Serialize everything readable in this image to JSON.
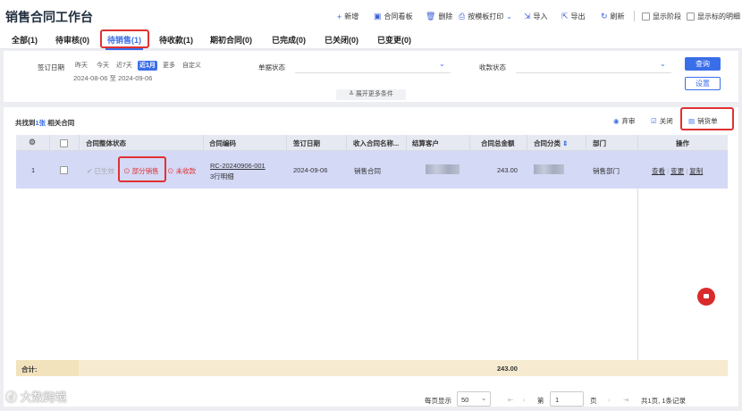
{
  "app": {
    "title": "销售合同工作台"
  },
  "toolbar": {
    "new": "新增",
    "board": "合同看板",
    "delete": "删除",
    "print": "按模板打印",
    "import": "导入",
    "export": "导出",
    "refresh": "刷新",
    "show_stage": "显示阶段",
    "show_detail": "显示标的明细"
  },
  "tabs": [
    {
      "label": "全部(1)"
    },
    {
      "label": "待审核(0)"
    },
    {
      "label": "待销售(1)"
    },
    {
      "label": "待收款(1)"
    },
    {
      "label": "期初合同(0)"
    },
    {
      "label": "已完成(0)"
    },
    {
      "label": "已关闭(0)"
    },
    {
      "label": "已变更(0)"
    }
  ],
  "active_tab": "待销售(1)",
  "filter": {
    "sign_date_label": "签订日期",
    "quick_dates": [
      "昨天",
      "今天",
      "近7天",
      "近1月",
      "更多",
      "自定义"
    ],
    "selected_quick_date": "近1月",
    "date_range": "2024-08-06 至 2024-09-06",
    "doc_status_label": "单据状态",
    "pay_status_label": "收款状态",
    "query_btn": "查询",
    "reset_btn": "设置",
    "expand_label": "展开更多条件"
  },
  "list": {
    "count_prefix": "共找到",
    "count_value": "1张",
    "count_suffix": "相关合同",
    "actions": {
      "reject": "弃审",
      "close": "关闭",
      "sales_order": "销货单"
    }
  },
  "table": {
    "headers": [
      "合同整体状态",
      "合同编码",
      "签订日期",
      "收入合同名称...",
      "结算客户",
      "合同总金额",
      "合同分类",
      "部门",
      "操作"
    ],
    "rows": [
      {
        "index": "1",
        "status_done": "已生效",
        "status_partial": "部分销售",
        "status_unpaid": "未收款",
        "code": "RC-20240906-001",
        "code_sub": "3行明细",
        "sign_date": "2024-09-06",
        "name": "销售合同",
        "amount": "243.00",
        "dept": "销售部门",
        "ops": [
          "查看",
          "变更",
          "复制"
        ]
      }
    ],
    "sum_label": "合计:",
    "sum_amount": "243.00"
  },
  "pager": {
    "per_page_label": "每页显示",
    "per_page": "50",
    "page_prefix": "第",
    "page": "1",
    "page_suffix": "页",
    "total": "共1页, 1条记录"
  },
  "watermark": "大数跨境"
}
